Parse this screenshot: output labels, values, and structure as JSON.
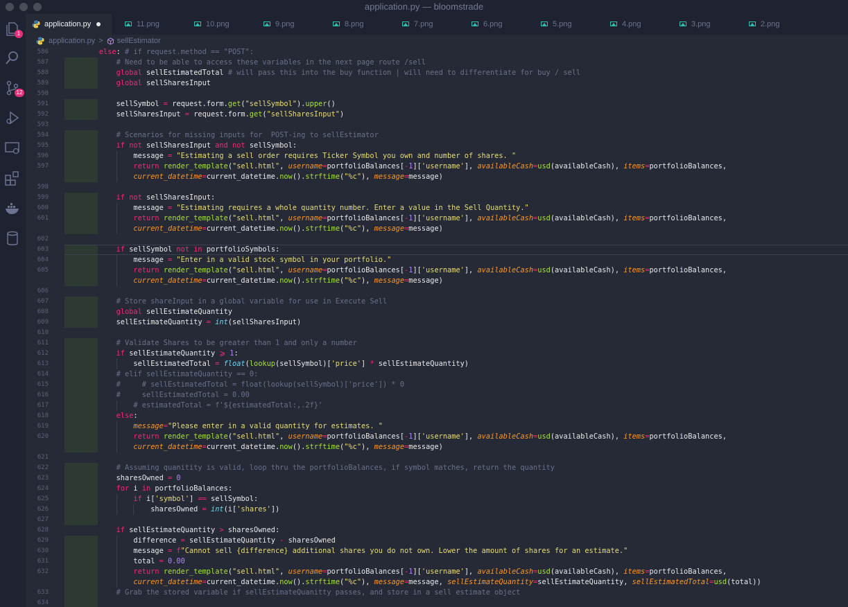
{
  "window": {
    "title": "application.py — bloomstrade"
  },
  "activity": {
    "explorer_badge": "1",
    "scm_badge": "12"
  },
  "tabs": [
    {
      "label": "application.py"
    },
    {
      "label": "11.png"
    },
    {
      "label": "10.png"
    },
    {
      "label": "9.png"
    },
    {
      "label": "8.png"
    },
    {
      "label": "7.png"
    },
    {
      "label": "6.png"
    },
    {
      "label": "5.png"
    },
    {
      "label": "4.png"
    },
    {
      "label": "3.png"
    },
    {
      "label": "2.png"
    }
  ],
  "breadcrumbs": {
    "file": "application.py",
    "separator": ">",
    "symbol": "sellEstimator"
  },
  "code": {
    "line_numbers": [
      "586",
      "587",
      "588",
      "589",
      "590",
      "591",
      "592",
      "593",
      "594",
      "595",
      "596",
      "597",
      "",
      "598",
      "599",
      "600",
      "601",
      "",
      "602",
      "603",
      "604",
      "605",
      "",
      "606",
      "607",
      "608",
      "609",
      "610",
      "611",
      "612",
      "613",
      "614",
      "615",
      "616",
      "617",
      "618",
      "619",
      "620",
      "",
      "621",
      "622",
      "623",
      "624",
      "625",
      "626",
      "627",
      "628",
      "629",
      "630",
      "631",
      "632",
      "",
      "633",
      "634"
    ],
    "lines": [
      "    else: # if request.method == \"POST\":",
      "        # Need to be able to access these variables in the next page route /sell",
      "        global sellEstimatedTotal # will pass this into the buy function | will need to differentiate for buy / sell",
      "        global sellSharesInput",
      "",
      "        sellSymbol = request.form.get(\"sellSymbol\").upper()",
      "        sellSharesInput = request.form.get(\"sellSharesInput\")",
      "",
      "        # Scenarios for missing inputs for  POST-ing to sellEstimator",
      "        if not sellSharesInput and not sellSymbol:",
      "            message = \"Estimating a sell order requires Ticker Symbol you own and number of shares. \"",
      "            return render_template(\"sell.html\", username=portfolioBalances[-1]['username'], availableCash=usd(availableCash), items=portfolioBalances,",
      "            current_datetime=current_datetime.now().strftime(\"%c\"), message=message)",
      "",
      "        if not sellSharesInput:",
      "            message = \"Estimating requires a whole quantity number. Enter a value in the Sell Quantity.\"",
      "            return render_template(\"sell.html\", username=portfolioBalances[-1]['username'], availableCash=usd(availableCash), items=portfolioBalances,",
      "            current_datetime=current_datetime.now().strftime(\"%c\"), message=message)",
      "",
      "        if sellSymbol not in portfolioSymbols:",
      "            message = \"Enter in a valid stock symbol in your portfolio.\"",
      "            return render_template(\"sell.html\", username=portfolioBalances[-1]['username'], availableCash=usd(availableCash), items=portfolioBalances,",
      "            current_datetime=current_datetime.now().strftime(\"%c\"), message=message)",
      "",
      "        # Store shareInput in a global variable for use in Execute Sell",
      "        global sellEstimateQuantity",
      "        sellEstimateQuantity = int(sellSharesInput)",
      "",
      "        # Validate Shares to be greater than 1 and only a number",
      "        if sellEstimateQuantity ⩾ 1:",
      "            sellEstimatedTotal = float(lookup(sellSymbol)['price'] * sellEstimateQuantity)",
      "        # elif sellEstimateQuantity == 0:",
      "        #     # sellEstimatedTotal = float(lookup(sellSymbol)['price']) * 0",
      "        #     sellEstimatedTotal = 0.00",
      "            # estimatedTotal = f'${estimatedTotal:,.2f}'",
      "        else:",
      "            message=\"Please enter in a valid quantity for estimates. \"",
      "            return render_template(\"sell.html\", username=portfolioBalances[-1]['username'], availableCash=usd(availableCash), items=portfolioBalances,",
      "            current_datetime=current_datetime.now().strftime(\"%c\"), message=message)",
      "",
      "        # Assuming quanitity is valid, loop thru the portfolioBalances, if symbol matches, return the quantity",
      "        sharesOwned = 0",
      "        for i in portfolioBalances:",
      "            if i['symbol'] == sellSymbol:",
      "                sharesOwned = int(i['shares'])",
      "",
      "        if sellEstimateQuantity > sharesOwned:",
      "            difference = sellEstimateQuantity - sharesOwned",
      "            message = f\"Cannot sell {difference} additional shares you do not own. Lower the amount of shares for an estimate.\"",
      "            total = 0.00",
      "            return render_template(\"sell.html\", username=portfolioBalances[-1]['username'], availableCash=usd(availableCash), items=portfolioBalances,",
      "            current_datetime=current_datetime.now().strftime(\"%c\"), message=message, sellEstimateQuantity=sellEstimateQuantity, sellEstimatedTotal=usd(total))",
      "        # Grab the stored variable if sellEstimateQuanitty passes, and store in a sell estimate object",
      ""
    ]
  }
}
